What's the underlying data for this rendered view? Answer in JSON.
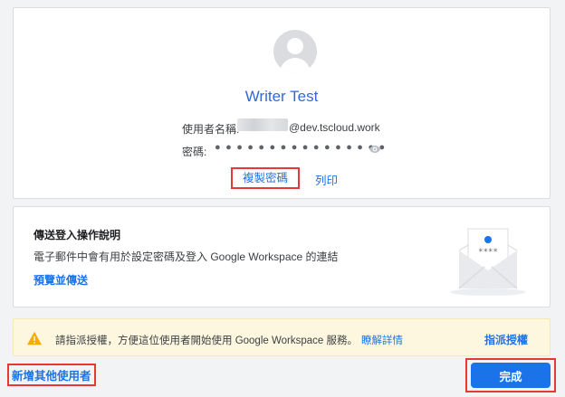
{
  "user_card": {
    "name": "Writer Test",
    "username_label": "使用者名稱:",
    "domain": "@dev.tscloud.work",
    "password_label": "密碼:",
    "password_mask": "● ● ● ● ● ● ● ● ● ● ● ● ● ● ● ●",
    "copy_password": "複製密碼",
    "print": "列印"
  },
  "send_card": {
    "title": "傳送登入操作說明",
    "description": "電子郵件中會有用於設定密碼及登入 Google Workspace 的連結",
    "preview_send": "預覽並傳送",
    "illustration_stars": "****"
  },
  "banner": {
    "text": "請指派授權，方便這位使用者開始使用 Google Workspace 服務。",
    "learn_more": "瞭解詳情",
    "assign_license": "指派授權"
  },
  "footer": {
    "add_user": "新增其他使用者",
    "done": "完成"
  },
  "colors": {
    "accent": "#1a73e8",
    "highlight_outline": "#e53935",
    "warning_bg": "#fef7e0",
    "warning_icon": "#f9ab00"
  }
}
